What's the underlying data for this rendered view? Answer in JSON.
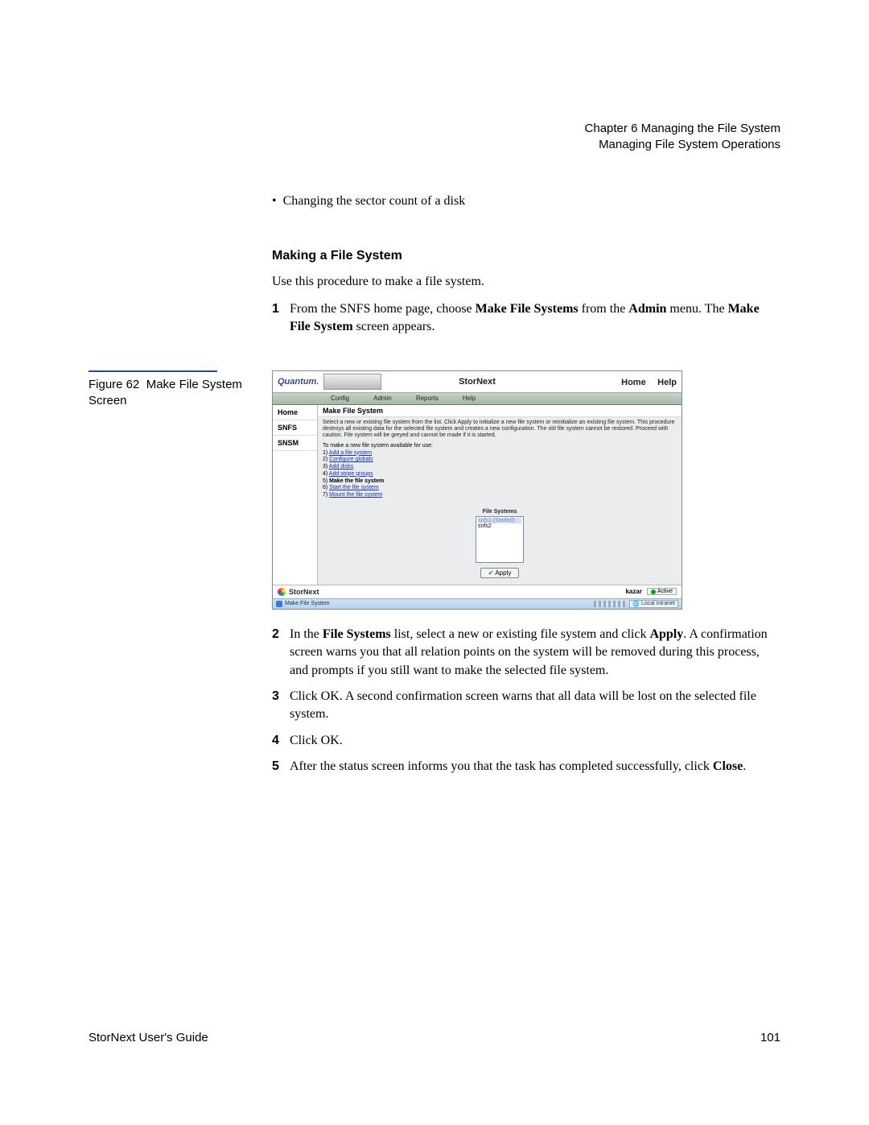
{
  "header": {
    "line1": "Chapter 6  Managing the File System",
    "line2": "Managing File System Operations"
  },
  "bullet1": "Changing the sector count of a disk",
  "section_heading": "Making a File System",
  "intro": "Use this procedure to make a file system.",
  "steps_top": {
    "n1": "1",
    "t1a": "From the SNFS home page, choose ",
    "t1b": "Make File Systems",
    "t1c": " from the ",
    "t1d": "Admin",
    "t1e": " menu. The ",
    "t1f": "Make File System",
    "t1g": " screen appears."
  },
  "figure": {
    "prefix": "Figure 62",
    "title": "Make File System Screen"
  },
  "screenshot": {
    "brand": "Quantum.",
    "title": "StorNext",
    "home": "Home",
    "help": "Help",
    "menus": {
      "config": "Config",
      "admin": "Admin",
      "reports": "Reports",
      "helpm": "Help"
    },
    "side": {
      "home": "Home",
      "snfs": "SNFS",
      "snsm": "SNSM"
    },
    "panel_title": "Make File System",
    "desc": "Select a new or existing file system from the list. Click Apply to initialize a new file system or reinitialize an existing file system. This procedure destroys all existing data for the selected file system and creates a new configuration. The old file system cannot be restored. Proceed with caution. File system will be greyed and cannot be made if it is started.",
    "steps_label": "To make a new file system available for use:",
    "s1": "Add a file system",
    "s2": "Configure globals",
    "s3": "Add disks",
    "s4": "Add stripe groups",
    "s5": "Make the file system",
    "s6": "Start the file system",
    "s7": "Mount the file system",
    "list_label": "File Systems",
    "items": {
      "i0": "snfs1  (Started)",
      "i1": "snfs2"
    },
    "apply": "Apply",
    "footer_brand": "StorNext",
    "host": "kazar",
    "active": "Active",
    "status_left": "Make File System",
    "status_zone": "Local intranet"
  },
  "steps_bottom": {
    "n2": "2",
    "t2a": "In the ",
    "t2b": "File Systems",
    "t2c": " list, select a new or existing file system and click ",
    "t2d": "Apply",
    "t2e": ". A confirmation screen warns you that all relation points on the system will be removed during this process, and prompts if you still want to make the selected file system.",
    "n3": "3",
    "t3": "Click OK. A second confirmation screen warns that all data will be lost on the selected file system.",
    "n4": "4",
    "t4": "Click OK.",
    "n5": "5",
    "t5a": "After the status screen informs you that the task has completed successfully, click ",
    "t5b": "Close",
    "t5c": "."
  },
  "footer": {
    "left": "StorNext User's Guide",
    "right": "101"
  }
}
